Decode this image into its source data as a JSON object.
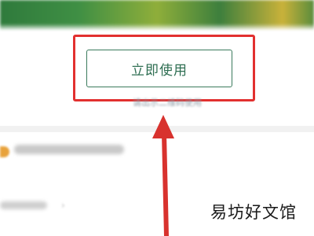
{
  "main": {
    "use_button_label": "立即使用",
    "qr_hint": "请出示二维码使用"
  },
  "annotation": {
    "highlight_color": "#e2302f",
    "arrow_color": "#d8322e"
  },
  "watermark": {
    "text": "易坊好文馆"
  }
}
